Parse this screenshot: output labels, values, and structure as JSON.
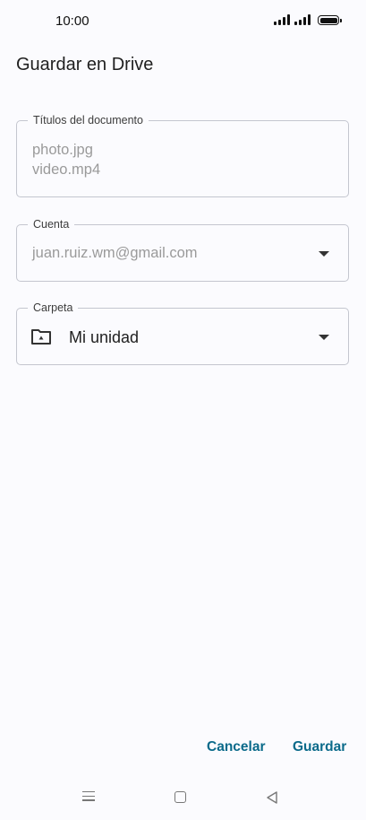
{
  "status_bar": {
    "time": "10:00"
  },
  "dialog": {
    "title": "Guardar en Drive",
    "documents_field": {
      "label": "Títulos del documento",
      "items": [
        "photo.jpg",
        "video.mp4"
      ]
    },
    "account_field": {
      "label": "Cuenta",
      "value": "juan.ruiz.wm@gmail.com"
    },
    "folder_field": {
      "label": "Carpeta",
      "value": "Mi unidad",
      "icon": "drive-folder-icon"
    },
    "actions": {
      "cancel_label": "Cancelar",
      "save_label": "Guardar"
    }
  },
  "nav_bar": {
    "icons": [
      "menu-icon",
      "home-icon",
      "back-icon"
    ]
  },
  "colors": {
    "accent": "#0a6a8a",
    "background": "#fbfbfe",
    "outline": "#c4c6cf",
    "disabled_text": "#9a9a9a"
  }
}
